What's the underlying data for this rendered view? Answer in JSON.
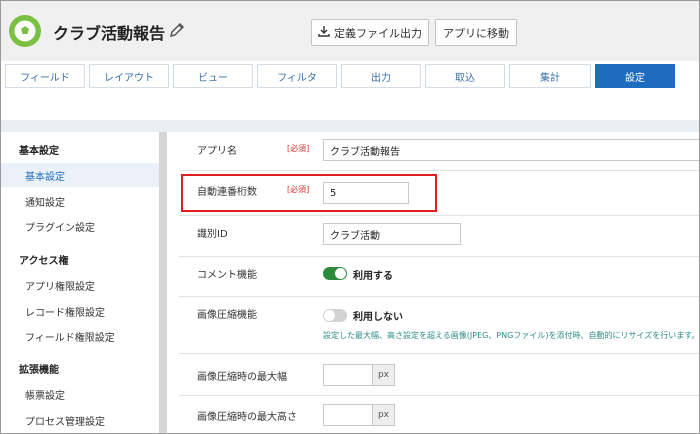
{
  "header": {
    "app_title": "クラブ活動報告",
    "export_button": "定義ファイル出力",
    "goto_app_button": "アプリに移動"
  },
  "tabs": [
    {
      "label": "フィールド",
      "active": false
    },
    {
      "label": "レイアウト",
      "active": false
    },
    {
      "label": "ビュー",
      "active": false
    },
    {
      "label": "フィルタ",
      "active": false
    },
    {
      "label": "出力",
      "active": false
    },
    {
      "label": "取込",
      "active": false
    },
    {
      "label": "集計",
      "active": false
    },
    {
      "label": "設定",
      "active": true
    }
  ],
  "sidebar": {
    "sections": [
      {
        "heading": "基本設定",
        "items": [
          "基本設定",
          "通知設定",
          "プラグイン設定"
        ]
      },
      {
        "heading": "アクセス権",
        "items": [
          "アプリ権限設定",
          "レコード権限設定",
          "フィールド権限設定"
        ]
      },
      {
        "heading": "拡張機能",
        "items": [
          "帳票設定",
          "プロセス管理設定"
        ]
      }
    ],
    "active_item": "基本設定"
  },
  "form": {
    "app_name": {
      "label": "アプリ名",
      "required": "[必須]",
      "value": "クラブ活動報告"
    },
    "serial_digits": {
      "label": "自動連番桁数",
      "required": "[必須]",
      "value": "5"
    },
    "identifier": {
      "label": "識別ID",
      "value": "クラブ活動"
    },
    "comment": {
      "label": "コメント機能",
      "toggle_on": true,
      "toggle_text": "利用する"
    },
    "image_compress": {
      "label": "画像圧縮機能",
      "toggle_on": false,
      "toggle_text": "利用しない",
      "note": "設定した最大幅、高さ設定を超える画像(JPEG、PNGファイル)を添付時、自動的にリサイズを行います。"
    },
    "max_width": {
      "label": "画像圧縮時の最大幅",
      "value": "",
      "unit": "px"
    },
    "max_height": {
      "label": "画像圧縮時の最大高さ",
      "value": "",
      "unit": "px"
    }
  },
  "colors": {
    "accent": "#1d6cbf",
    "highlight_border": "#e02020",
    "toggle_on": "#2e8b3c",
    "logo": "#7cc043"
  }
}
